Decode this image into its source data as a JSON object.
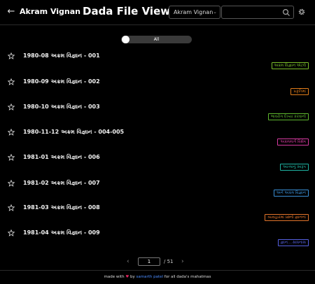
{
  "header": {
    "back_icon": "arrow-left-icon",
    "app_name": "Akram Vignan",
    "title": "Dada File Viewer",
    "select_value": "Akram Vignan",
    "search_placeholder": "",
    "search_icon": "search-icon",
    "settings_icon": "gear-icon"
  },
  "filter": {
    "label": "All",
    "toggle_on": false
  },
  "items": [
    {
      "name": "1980-08 અક્રમ વિજ્ઞાન - 001",
      "tag": "અક્રમ વિજ્ઞાન એટલે",
      "tag_color": "#7bbf2a"
    },
    {
      "name": "1980-09 અક્રમ વિજ્ઞાન - 002",
      "tag": "પ્રકૃતિમાં",
      "tag_color": "#e07c1a"
    },
    {
      "name": "1980-10 અક્રમ વિજ્ઞાન - 003",
      "tag": "ભાવરોગ દેખ્યા કરવાનો",
      "tag_color": "#5fb82e"
    },
    {
      "name": "1980-11-12 અક્રમ વિજ્ઞાન - 004-005",
      "tag": "અક્રમમાર્ગ વિશેષ",
      "tag_color": "#d63aa0"
    },
    {
      "name": "1981-01 અક્રમ વિજ્ઞાન - 006",
      "tag": "આત્માનું સ્વરૂપ",
      "tag_color": "#1fb5a3"
    },
    {
      "name": "1981-02 અક્રમ વિજ્ઞાન - 007",
      "tag": "અને અક્રમ વિજ્ઞાન",
      "tag_color": "#3a8fd6"
    },
    {
      "name": "1981-03 અક્રમ વિજ્ઞાન - 008",
      "tag": "વ્યવહારમાં પ્રશ્નો જ્ઞાનનાં",
      "tag_color": "#e0732a"
    },
    {
      "name": "1981-04 અક્રમ વિજ્ઞાન - 009",
      "tag": "જ્ઞાન....સાધનાસ",
      "tag_color": "#5560e0"
    }
  ],
  "pagination": {
    "prev_icon": "chevron-left-icon",
    "current_page": "1",
    "total": "/ 51",
    "next_icon": "chevron-right-icon"
  },
  "footer": {
    "prefix": "made with",
    "heart": "♥",
    "by": "by",
    "author": "samarth patel",
    "suffix": "for all dada's mahatmas"
  },
  "colors": {
    "background": "#000000",
    "footer_link": "#4c8dff",
    "heart": "#e0245e"
  }
}
